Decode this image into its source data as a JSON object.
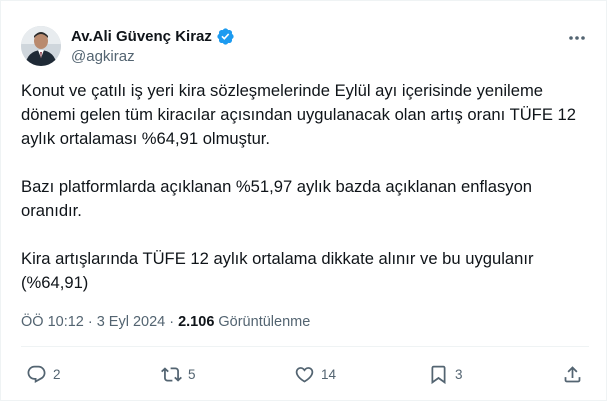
{
  "author": {
    "name": "Av.Ali Güvenç Kiraz",
    "handle": "@agkiraz",
    "verified": true,
    "avatar_icon": "profile-photo"
  },
  "tweet": {
    "text": "Konut ve çatılı iş yeri kira sözleşmelerinde Eylül ayı içerisinde yenileme dönemi gelen tüm kiracılar açısından uygulanacak olan artış oranı TÜFE 12 aylık ortalaması %64,91 olmuştur.\n\nBazı platformlarda açıklanan %51,97 aylık bazda açıklanan enflasyon oranıdır.\n\nKira artışlarında TÜFE 12 aylık ortalama dikkate alınır ve bu uygulanır (%64,91)",
    "time": "ÖÖ 10:12",
    "separator": "·",
    "date": "3 Eyl 2024",
    "views_count": "2.106",
    "views_label": "Görüntülenme"
  },
  "actions": {
    "reply_count": "2",
    "retweet_count": "5",
    "like_count": "14",
    "bookmark_count": "3"
  },
  "colors": {
    "accent": "#1d9bf0",
    "secondary_text": "#536471",
    "primary_text": "#0f1419"
  },
  "icons": [
    "verified-badge-icon",
    "more-icon",
    "reply-icon",
    "retweet-icon",
    "like-icon",
    "bookmark-icon",
    "share-icon"
  ]
}
